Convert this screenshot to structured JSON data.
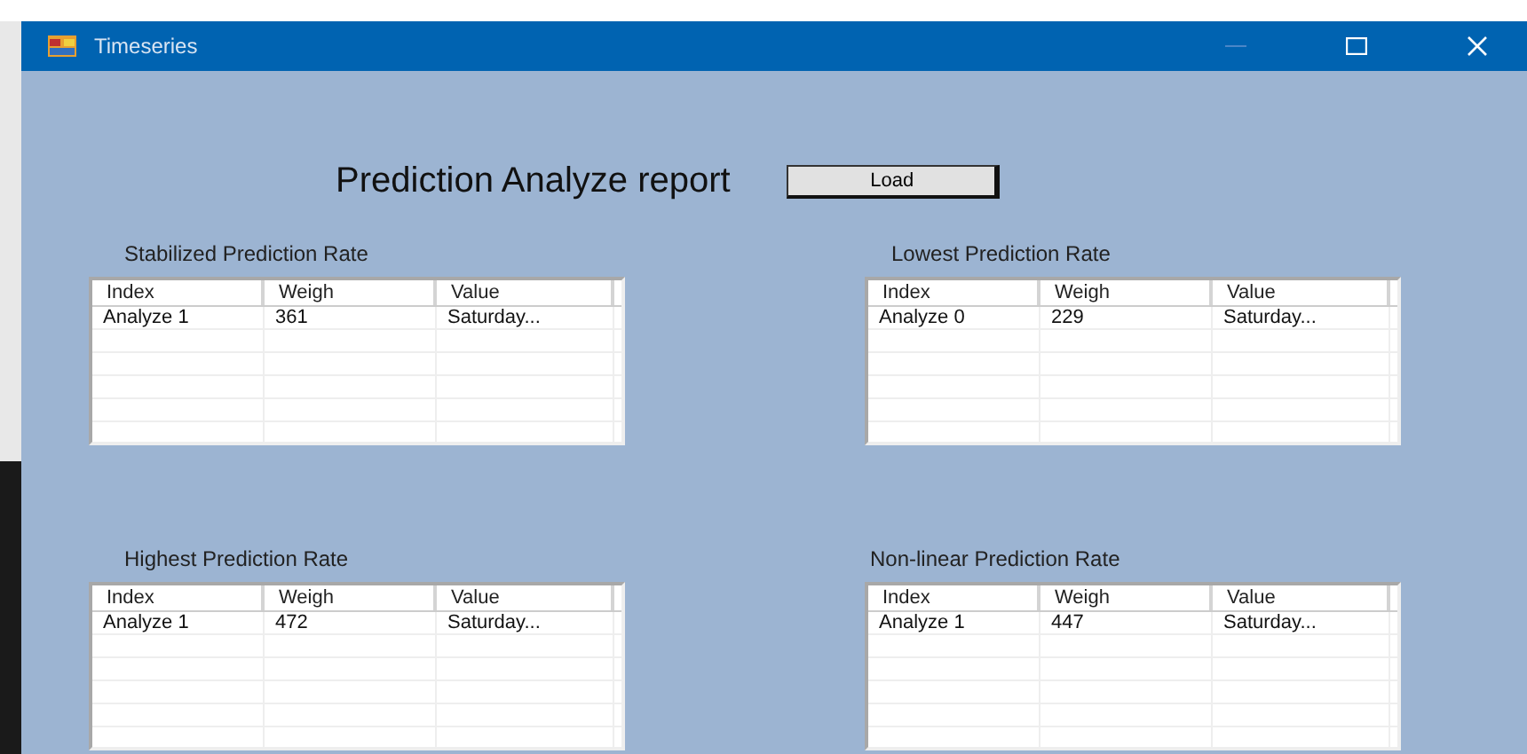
{
  "window": {
    "title": "Timeseries"
  },
  "heading": "Prediction Analyze report",
  "load_button": "Load",
  "panels": [
    {
      "title": "Stabilized Prediction Rate",
      "columns": [
        "Index",
        "Weigh",
        "Value"
      ],
      "rows": [
        [
          "Analyze 1",
          "361",
          "Saturday..."
        ]
      ]
    },
    {
      "title": "Lowest Prediction Rate",
      "columns": [
        "Index",
        "Weigh",
        "Value"
      ],
      "rows": [
        [
          "Analyze 0",
          "229",
          "Saturday..."
        ]
      ]
    },
    {
      "title": "Highest Prediction Rate",
      "columns": [
        "Index",
        "Weigh",
        "Value"
      ],
      "rows": [
        [
          "Analyze 1",
          "472",
          "Saturday..."
        ]
      ]
    },
    {
      "title": "Non-linear Prediction Rate",
      "columns": [
        "Index",
        "Weigh",
        "Value"
      ],
      "rows": [
        [
          "Analyze 1",
          "447",
          "Saturday..."
        ]
      ]
    }
  ]
}
